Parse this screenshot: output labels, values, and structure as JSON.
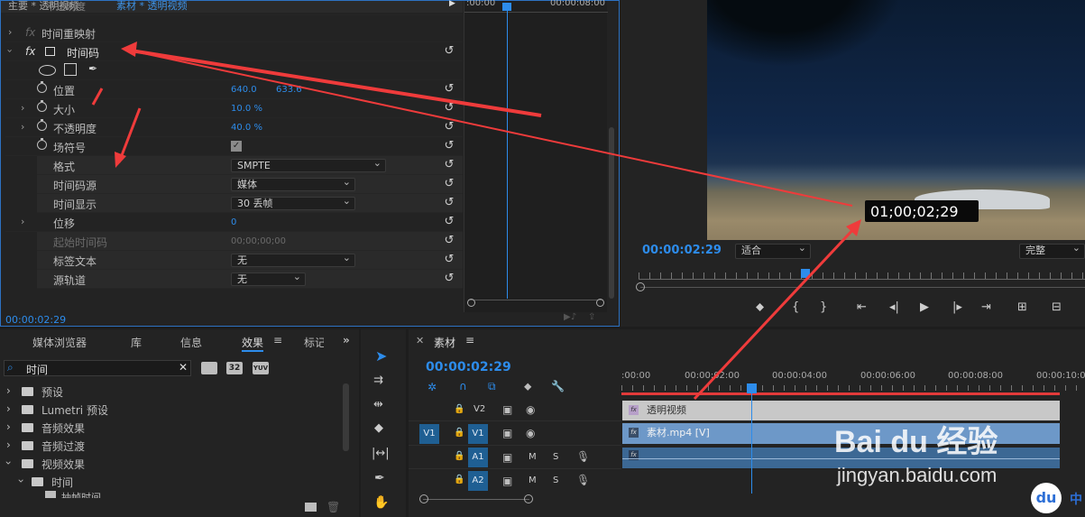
{
  "effect_controls": {
    "tab_main": "主要 * 透明视频",
    "tab_source": "素材 * 透明视频",
    "ruler_start": ":00:00",
    "ruler_end": "00:00:08:00",
    "rows": {
      "opacity_partial": "不透明度",
      "time_remap": "时间重映射",
      "timecode_effect": "时间码",
      "position_label": "位置",
      "position_x": "640.0",
      "position_y": "633.6",
      "scale_label": "大小",
      "scale_value": "10.0 %",
      "opacity_label": "不透明度",
      "opacity_value": "40.0 %",
      "field_label": "场符号",
      "format_label": "格式",
      "format_value": "SMPTE",
      "tc_source_label": "时间码源",
      "tc_source_value": "媒体",
      "tc_display_label": "时间显示",
      "tc_display_value": "30 丢帧",
      "offset_label": "位移",
      "offset_value": "0",
      "start_tc_label": "起始时间码",
      "start_tc_value": "00;00;00;00",
      "label_text_label": "标签文本",
      "label_text_value": "无",
      "source_track_label": "源轨道",
      "source_track_value": "无"
    },
    "footer_time": "00:00:02:29"
  },
  "program_monitor": {
    "overlay_timecode": "01;00;02;29",
    "current_time": "00:00:02:29",
    "fit_select": "适合",
    "quality_select": "完整"
  },
  "effects_panel": {
    "tabs": [
      "媒体浏览器",
      "库",
      "信息",
      "效果",
      "标记"
    ],
    "search_value": "时间",
    "badges": [
      "32",
      "YUV"
    ],
    "tree": [
      "预设",
      "Lumetri 预设",
      "音频效果",
      "音频过渡",
      "视频效果",
      "时间",
      "抽帧时间"
    ]
  },
  "timeline": {
    "tab_label": "素材",
    "current_time": "00:00:02:29",
    "ruler": [
      ":00:00",
      "00:00:02:00",
      "00:00:04:00",
      "00:00:06:00",
      "00:00:08:00",
      "00:00:10:00"
    ],
    "tracks": {
      "v2": "V2",
      "v1": "V1",
      "v1_src": "V1",
      "a1": "A1",
      "a2": "A2",
      "m": "M",
      "s": "S"
    },
    "clip_v2": "透明视频",
    "clip_v1": "素材.mp4 [V]",
    "fx": "fx"
  },
  "watermark": {
    "brand": "Bai du 经验",
    "url": "jingyan.baidu.com",
    "badge": "du",
    "badge_text": "中"
  },
  "colors": {
    "accent": "#2d8ceb",
    "annotation": "#ef3b3b",
    "clip_v2": "#c8c8c8",
    "clip_v1": "#6d98c8"
  }
}
